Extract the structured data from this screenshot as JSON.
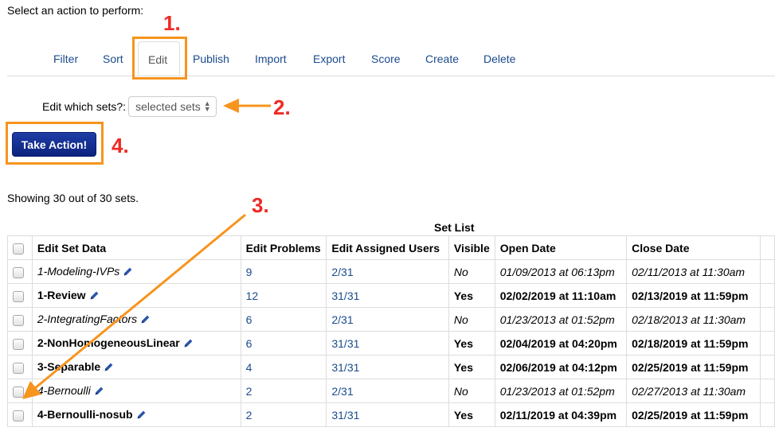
{
  "prompt": "Select an action to perform:",
  "tabs": [
    {
      "label": "Filter",
      "active": false
    },
    {
      "label": "Sort",
      "active": false
    },
    {
      "label": "Edit",
      "active": true
    },
    {
      "label": "Publish",
      "active": false
    },
    {
      "label": "Import",
      "active": false
    },
    {
      "label": "Export",
      "active": false
    },
    {
      "label": "Score",
      "active": false
    },
    {
      "label": "Create",
      "active": false
    },
    {
      "label": "Delete",
      "active": false
    }
  ],
  "edit_form": {
    "label": "Edit which sets?:",
    "select_value": "selected sets"
  },
  "take_action_label": "Take Action!",
  "showing_text": "Showing 30 out of 30 sets.",
  "annotations": {
    "n1": "1.",
    "n2": "2.",
    "n3": "3.",
    "n4": "4."
  },
  "annotation_color": "#f7941d",
  "annotation_number_color": "#ee2a24",
  "table": {
    "caption": "Set List",
    "headers": [
      "Edit Set Data",
      "Edit Problems",
      "Edit Assigned Users",
      "Visible",
      "Open Date",
      "Close Date"
    ],
    "rows": [
      {
        "name": "1-Modeling-IVPs",
        "problems": "9",
        "users": "2/31",
        "visible": "No",
        "open": "01/09/2013 at 06:13pm",
        "close": "02/11/2013 at 11:30am",
        "style": "it"
      },
      {
        "name": "1-Review",
        "problems": "12",
        "users": "31/31",
        "visible": "Yes",
        "open": "02/02/2019 at 11:10am",
        "close": "02/13/2019 at 11:59pm",
        "style": "bd"
      },
      {
        "name": "2-IntegratingFactors",
        "problems": "6",
        "users": "2/31",
        "visible": "No",
        "open": "01/23/2013 at 01:52pm",
        "close": "02/18/2013 at 11:30am",
        "style": "it"
      },
      {
        "name": "2-NonHomogeneousLinear",
        "problems": "6",
        "users": "31/31",
        "visible": "Yes",
        "open": "02/04/2019 at 04:20pm",
        "close": "02/18/2019 at 11:59pm",
        "style": "bd"
      },
      {
        "name": "3-Separable",
        "problems": "4",
        "users": "31/31",
        "visible": "Yes",
        "open": "02/06/2019 at 04:12pm",
        "close": "02/25/2019 at 11:59pm",
        "style": "bd"
      },
      {
        "name": "4-Bernoulli",
        "problems": "2",
        "users": "2/31",
        "visible": "No",
        "open": "01/23/2013 at 01:52pm",
        "close": "02/27/2013 at 11:30am",
        "style": "it"
      },
      {
        "name": "4-Bernoulli-nosub",
        "problems": "2",
        "users": "31/31",
        "visible": "Yes",
        "open": "02/11/2019 at 04:39pm",
        "close": "02/25/2019 at 11:59pm",
        "style": "bd"
      }
    ]
  }
}
